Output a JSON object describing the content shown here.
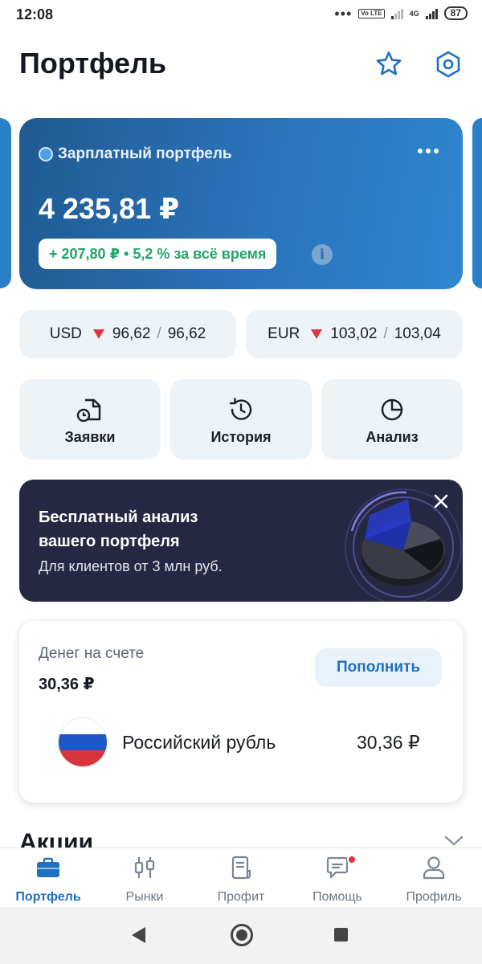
{
  "status_bar": {
    "time": "12:08",
    "network_label": "4G",
    "volte_label": "Vo LTE",
    "battery": "87"
  },
  "header": {
    "title": "Портфель",
    "favorite_icon": "star-icon",
    "settings_icon": "hexagon-settings-icon"
  },
  "portfolio": {
    "name": "Зарплатный портфель",
    "total": "4 235,81 ₽",
    "change": "+ 207,80 ₽ • 5,2 % за всё время",
    "colors": {
      "card_start": "#205a92",
      "card_end": "#2f86d1",
      "change_positive": "#25a36a"
    }
  },
  "currencies": [
    {
      "code": "USD",
      "buy": "96,62",
      "sell": "96,62",
      "sep": "/",
      "trend": "down"
    },
    {
      "code": "EUR",
      "buy": "103,02",
      "sell": "103,04",
      "sep": "/",
      "trend": "down"
    }
  ],
  "actions": [
    {
      "label": "Заявки",
      "icon": "orders-clock-doc-icon"
    },
    {
      "label": "История",
      "icon": "history-icon"
    },
    {
      "label": "Анализ",
      "icon": "pie-chart-icon"
    }
  ],
  "promo": {
    "title": "Бесплатный анализ вашего портфеля",
    "subtitle": "Для клиентов от 3 млн руб."
  },
  "balance": {
    "label": "Денег на счете",
    "value": "30,36 ₽",
    "topup_label": "Пополнить",
    "currency_name": "Российский рубль",
    "currency_value": "30,36 ₽"
  },
  "section": {
    "title": "Акции"
  },
  "bottom_nav": [
    {
      "label": "Портфель",
      "icon": "briefcase-icon",
      "active": true
    },
    {
      "label": "Рынки",
      "icon": "candles-icon",
      "active": false
    },
    {
      "label": "Профит",
      "icon": "document-icon",
      "active": false
    },
    {
      "label": "Помощь",
      "icon": "chat-icon",
      "active": false,
      "has_notification": true
    },
    {
      "label": "Профиль",
      "icon": "person-icon",
      "active": false
    }
  ],
  "accent_color": "#1f6fc3"
}
